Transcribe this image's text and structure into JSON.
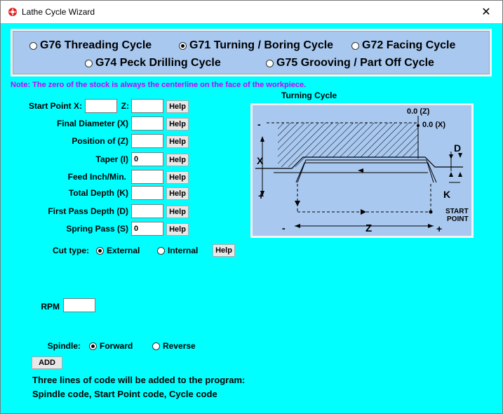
{
  "window": {
    "title": "Lathe Cycle Wizard",
    "close_glyph": "✕"
  },
  "cycles": [
    {
      "label": "G76 Threading Cycle",
      "checked": false
    },
    {
      "label": "G71 Turning / Boring Cycle",
      "checked": true
    },
    {
      "label": "G72 Facing Cycle",
      "checked": false
    },
    {
      "label": "G74 Peck Drilling Cycle",
      "checked": false
    },
    {
      "label": "G75 Grooving / Part Off Cycle",
      "checked": false
    }
  ],
  "note": "Note: The zero of the stock is always the centerline on the face of the workpiece.",
  "fields": {
    "start_x": {
      "label": "Start Point X:",
      "value": ""
    },
    "start_z": {
      "label": "Z:",
      "value": ""
    },
    "final_diameter": {
      "label": "Final Diameter (X)",
      "value": ""
    },
    "position_z": {
      "label": "Position of (Z)",
      "value": ""
    },
    "taper": {
      "label": "Taper  (I)",
      "value": "0"
    },
    "feed": {
      "label": "Feed Inch/Min.",
      "value": ""
    },
    "total_depth": {
      "label": "Total Depth (K)",
      "value": ""
    },
    "first_pass": {
      "label": "First Pass Depth (D)",
      "value": ""
    },
    "spring_pass": {
      "label": "Spring Pass (S)",
      "value": "0"
    }
  },
  "help_label": "Help",
  "cut_type": {
    "label": "Cut type:",
    "options": [
      {
        "label": "External",
        "checked": true
      },
      {
        "label": "Internal",
        "checked": false
      }
    ]
  },
  "rpm": {
    "label": "RPM",
    "value": ""
  },
  "spindle": {
    "label": "Spindle:",
    "options": [
      {
        "label": "Forward",
        "checked": true
      },
      {
        "label": "Reverse",
        "checked": false
      }
    ]
  },
  "add_label": "ADD",
  "info_lines": [
    "Three lines of code will be added to the program:",
    "Spindle code, Start Point code, Cycle code"
  ],
  "diagram": {
    "title": "Turning Cycle",
    "zero_z": "0.0 (Z)",
    "zero_x": "0.0 (X)",
    "x_label": "X",
    "z_label": "Z",
    "d_label": "D",
    "k_label": "K",
    "start_point": "START",
    "start_point2": "POINT",
    "minus": "-",
    "plus": "+"
  }
}
